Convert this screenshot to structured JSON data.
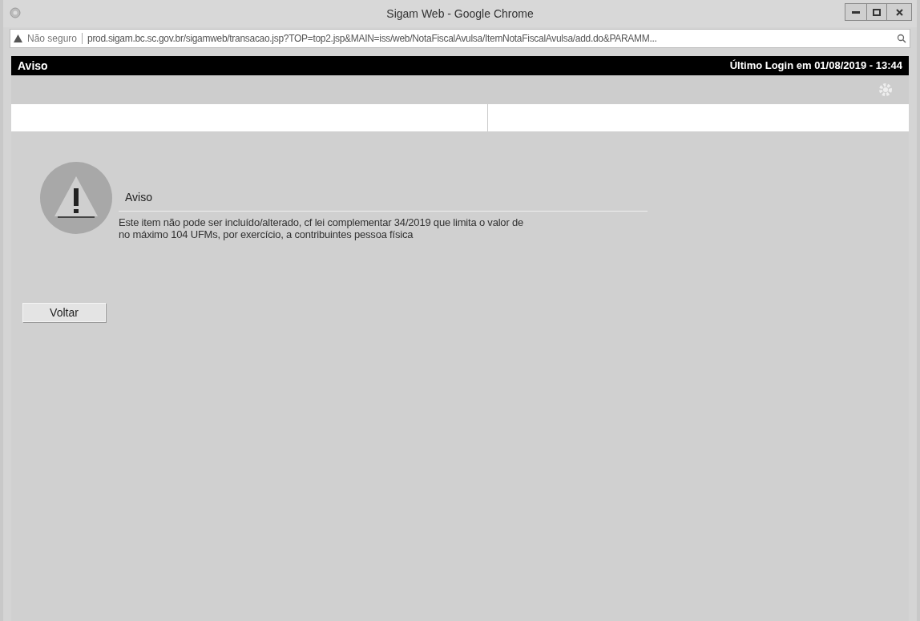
{
  "window": {
    "title": "Sigam Web - Google Chrome"
  },
  "address_bar": {
    "security": "Não seguro",
    "url": "prod.sigam.bc.sc.gov.br/sigamweb/transacao.jsp?TOP=top2.jsp&MAIN=iss/web/NotaFiscalAvulsa/ItemNotaFiscalAvulsa/add.do&PARAMM..."
  },
  "header": {
    "title": "Aviso",
    "last_login": "Último Login em 01/08/2019 - 13:44"
  },
  "alert": {
    "title": "Aviso",
    "message": "Este item não pode ser incluído/alterado, cf lei complementar 34/2019 que limita o valor de\nno máximo 104 UFMs, por exercício, a contribuintes pessoa física"
  },
  "buttons": [
    "Voltar"
  ]
}
